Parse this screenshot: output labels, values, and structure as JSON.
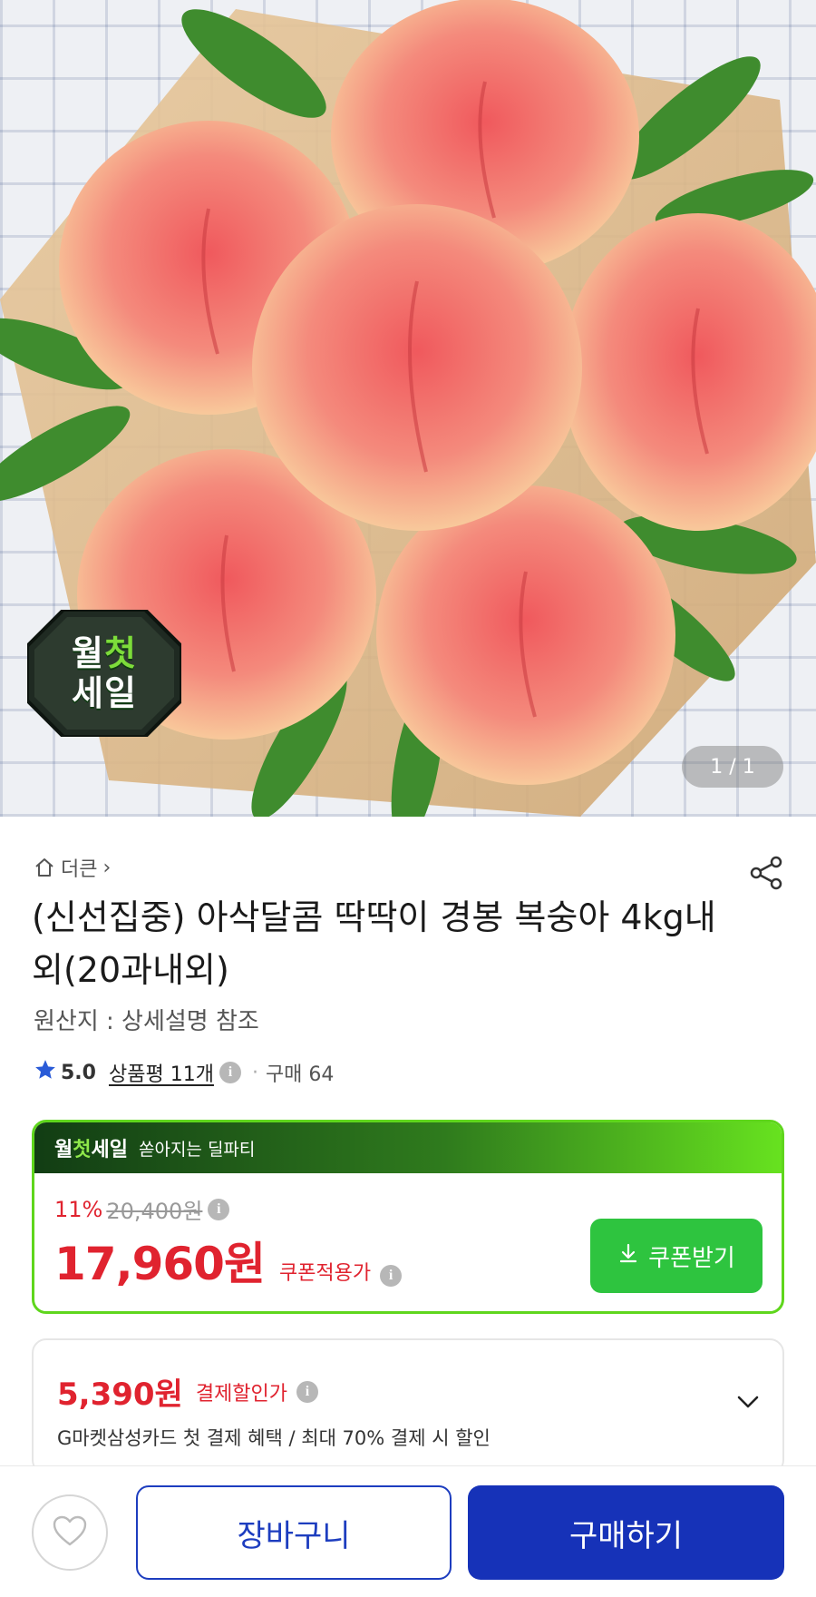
{
  "hero": {
    "badge": {
      "line1_a": "월",
      "line1_b": "첫",
      "line2": "세일"
    },
    "page_indicator": "1 / 1"
  },
  "breadcrumb": {
    "store": "더큰",
    "chevron": "›"
  },
  "product": {
    "title": "(신선집중) 아삭달콤 딱딱이 경봉 복숭아 4kg내외(20과내외)",
    "origin": "원산지 : 상세설명 참조",
    "rating": "5.0",
    "reviews": "상품평 11개",
    "separator": "·",
    "purchases": "구매 64"
  },
  "deal": {
    "brand_a": "월",
    "brand_b": "첫",
    "brand_c": "세일",
    "slogan": "쏟아지는 딜파티",
    "discount_pct": "11%",
    "original_price": "20,400원",
    "price": "17,960원",
    "price_label": "쿠폰적용가",
    "coupon_button": "쿠폰받기"
  },
  "payment": {
    "price": "5,390원",
    "label": "결제할인가",
    "description": "G마켓삼성카드 첫 결제 혜택 / 최대 70% 결제 시 할인"
  },
  "bottom_bar": {
    "cart_button": "장바구니",
    "buy_button": "구매하기"
  },
  "colors": {
    "price_red": "#e0232f",
    "deal_green": "#5fd61d",
    "coupon_green": "#2ec43f",
    "primary_blue": "#1632b8"
  },
  "icons": [
    "home-icon",
    "share-icon",
    "star-icon",
    "info-icon",
    "download-icon",
    "chevron-down-icon",
    "heart-icon"
  ]
}
